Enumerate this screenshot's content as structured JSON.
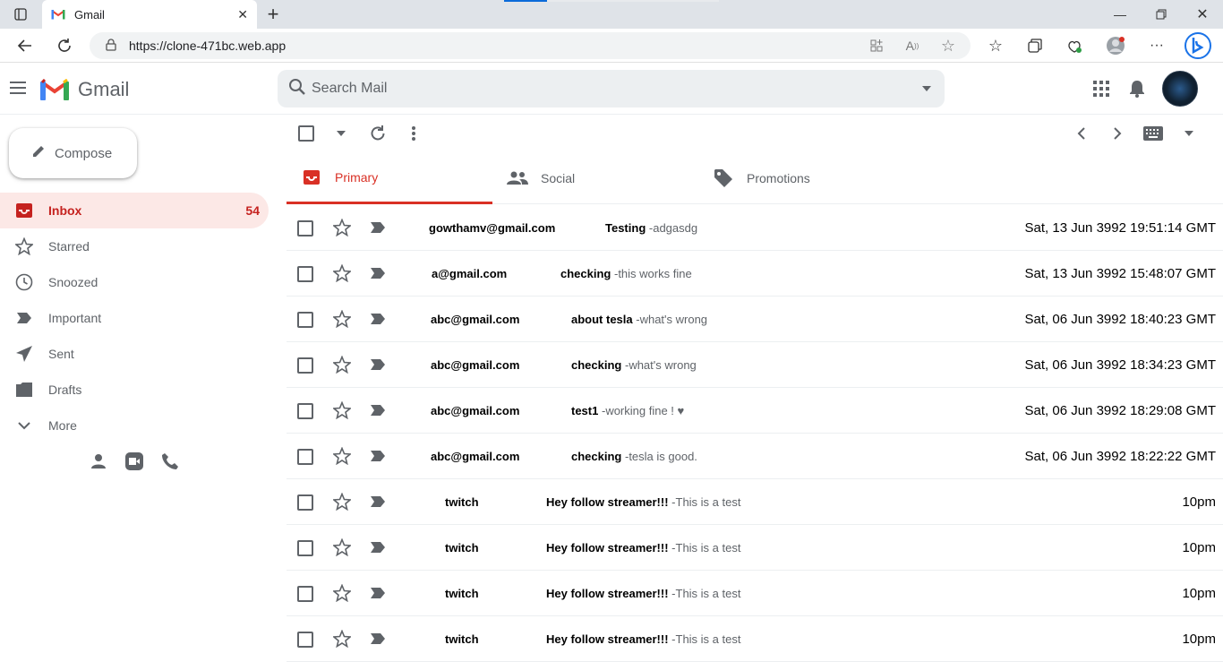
{
  "browser": {
    "tab_title": "Gmail",
    "url": "https://clone-471bc.web.app"
  },
  "header": {
    "app_name": "Gmail",
    "search_placeholder": "Search Mail"
  },
  "sidebar": {
    "compose_label": "Compose",
    "items": [
      {
        "label": "Inbox",
        "count": "54",
        "icon": "inbox-icon",
        "active": true
      },
      {
        "label": "Starred",
        "count": "",
        "icon": "star-icon"
      },
      {
        "label": "Snoozed",
        "count": "",
        "icon": "clock-icon"
      },
      {
        "label": "Important",
        "count": "",
        "icon": "label-important-icon"
      },
      {
        "label": "Sent",
        "count": "",
        "icon": "send-icon"
      },
      {
        "label": "Drafts",
        "count": "",
        "icon": "draft-icon"
      },
      {
        "label": "More",
        "count": "",
        "icon": "chevron-down-icon"
      }
    ]
  },
  "tabs": [
    {
      "label": "Primary",
      "icon": "inbox-icon",
      "active": true
    },
    {
      "label": "Social",
      "icon": "people-icon"
    },
    {
      "label": "Promotions",
      "icon": "tag-icon"
    }
  ],
  "emails": [
    {
      "sender": "gowthamv@gmail.com",
      "subject": "Testing",
      "snippet": "-adgasdg",
      "date": "Sat, 13 Jun 3992 19:51:14 GMT"
    },
    {
      "sender": "a@gmail.com",
      "subject": "checking",
      "snippet": "-this works fine",
      "date": "Sat, 13 Jun 3992 15:48:07 GMT"
    },
    {
      "sender": "abc@gmail.com",
      "subject": "about tesla",
      "snippet": "-what's wrong",
      "date": "Sat, 06 Jun 3992 18:40:23 GMT"
    },
    {
      "sender": "abc@gmail.com",
      "subject": "checking",
      "snippet": "-what's wrong",
      "date": "Sat, 06 Jun 3992 18:34:23 GMT"
    },
    {
      "sender": "abc@gmail.com",
      "subject": "test1",
      "snippet": "-working fine ! ♥",
      "date": "Sat, 06 Jun 3992 18:29:08 GMT"
    },
    {
      "sender": "abc@gmail.com",
      "subject": "checking",
      "snippet": "-tesla is good.",
      "date": "Sat, 06 Jun 3992 18:22:22 GMT"
    },
    {
      "sender": "twitch",
      "subject": "Hey follow streamer!!!",
      "snippet": "-This is a test",
      "date": "10pm"
    },
    {
      "sender": "twitch",
      "subject": "Hey follow streamer!!!",
      "snippet": "-This is a test",
      "date": "10pm"
    },
    {
      "sender": "twitch",
      "subject": "Hey follow streamer!!!",
      "snippet": "-This is a test",
      "date": "10pm"
    },
    {
      "sender": "twitch",
      "subject": "Hey follow streamer!!!",
      "snippet": "-This is a test",
      "date": "10pm"
    }
  ],
  "colors": {
    "accent": "#d93025",
    "active_bg": "#fce8e6"
  }
}
